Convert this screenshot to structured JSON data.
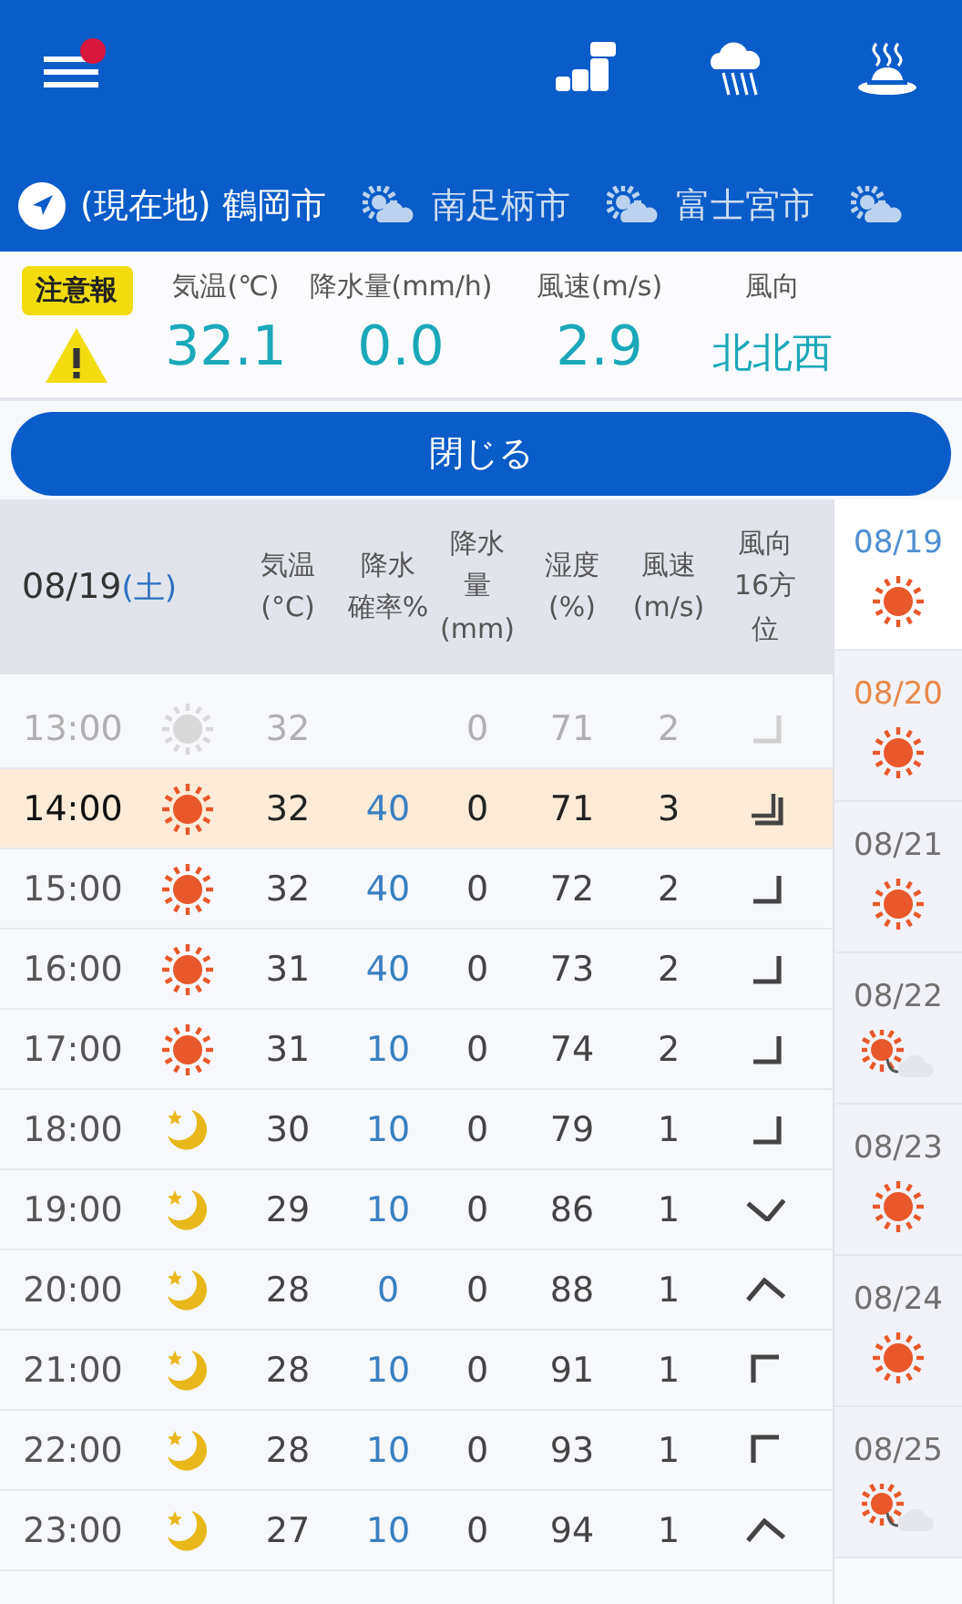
{
  "header": {
    "menu_badge": true,
    "icons": [
      {
        "kind": "blocks"
      },
      {
        "kind": "rain"
      },
      {
        "kind": "onsen"
      }
    ]
  },
  "locations": [
    {
      "kind": "current",
      "label": "(現在地) 鶴岡市",
      "selected": true
    },
    {
      "kind": "partly-cloudy",
      "label": "南足柄市",
      "selected": false
    },
    {
      "kind": "partly-cloudy",
      "label": "富士宮市",
      "selected": false
    },
    {
      "kind": "partly-cloudy",
      "selected": false
    }
  ],
  "now": {
    "alert": "注意報",
    "columns": [
      {
        "label": "気温(℃)",
        "value": "32.1"
      },
      {
        "label": "降水量(mm/h)",
        "value": "0.0"
      },
      {
        "label": "風速(m/s)",
        "value": "2.9"
      },
      {
        "label": "風向",
        "value": "北北西"
      }
    ]
  },
  "close_button": "閉じる",
  "table": {
    "date": "08/19",
    "weekday": "(土)",
    "columns": [
      [
        "気温",
        "(°C)"
      ],
      [
        "降水",
        "確率%"
      ],
      [
        "降水",
        "量",
        "(mm)"
      ],
      [
        "湿度",
        "(%)"
      ],
      [
        "風速",
        "(m/s)"
      ],
      [
        "風向",
        "16方",
        "位"
      ]
    ],
    "rows": [
      {
        "time": "13:00",
        "kind": "sun",
        "temp": "32",
        "pop": "",
        "precip": "0",
        "humidity": "71",
        "wind": "2",
        "arrow": {
          "kind": "se",
          "strong": false
        },
        "past": true,
        "current": false
      },
      {
        "time": "14:00",
        "kind": "sun",
        "temp": "32",
        "pop": "40",
        "precip": "0",
        "humidity": "71",
        "wind": "3",
        "arrow": {
          "kind": "se",
          "strong": true
        },
        "past": false,
        "current": true
      },
      {
        "time": "15:00",
        "kind": "sun",
        "temp": "32",
        "pop": "40",
        "precip": "0",
        "humidity": "72",
        "wind": "2",
        "arrow": {
          "kind": "se",
          "strong": false
        },
        "past": false,
        "current": false
      },
      {
        "time": "16:00",
        "kind": "sun",
        "temp": "31",
        "pop": "40",
        "precip": "0",
        "humidity": "73",
        "wind": "2",
        "arrow": {
          "kind": "se",
          "strong": false
        },
        "past": false,
        "current": false
      },
      {
        "time": "17:00",
        "kind": "sun",
        "temp": "31",
        "pop": "10",
        "precip": "0",
        "humidity": "74",
        "wind": "2",
        "arrow": {
          "kind": "se",
          "strong": false
        },
        "past": false,
        "current": false
      },
      {
        "time": "18:00",
        "kind": "moon",
        "temp": "30",
        "pop": "10",
        "precip": "0",
        "humidity": "79",
        "wind": "1",
        "arrow": {
          "kind": "se",
          "strong": false
        },
        "past": false,
        "current": false
      },
      {
        "time": "19:00",
        "kind": "moon",
        "temp": "29",
        "pop": "10",
        "precip": "0",
        "humidity": "86",
        "wind": "1",
        "arrow": {
          "kind": "s",
          "strong": false
        },
        "past": false,
        "current": false
      },
      {
        "time": "20:00",
        "kind": "moon",
        "temp": "28",
        "pop": "0",
        "precip": "0",
        "humidity": "88",
        "wind": "1",
        "arrow": {
          "kind": "n",
          "strong": false
        },
        "past": false,
        "current": false
      },
      {
        "time": "21:00",
        "kind": "moon",
        "temp": "28",
        "pop": "10",
        "precip": "0",
        "humidity": "91",
        "wind": "1",
        "arrow": {
          "kind": "nw",
          "strong": false
        },
        "past": false,
        "current": false
      },
      {
        "time": "22:00",
        "kind": "moon",
        "temp": "28",
        "pop": "10",
        "precip": "0",
        "humidity": "93",
        "wind": "1",
        "arrow": {
          "kind": "nw",
          "strong": false
        },
        "past": false,
        "current": false
      },
      {
        "time": "23:00",
        "kind": "moon",
        "temp": "27",
        "pop": "10",
        "precip": "0",
        "humidity": "94",
        "wind": "1",
        "arrow": {
          "kind": "n",
          "strong": false
        },
        "past": false,
        "current": false
      }
    ]
  },
  "days": [
    {
      "date": "08/19",
      "color": "#4f8fd0",
      "kind": "sun",
      "selected": true
    },
    {
      "date": "08/20",
      "color": "#e8884a",
      "kind": "sun",
      "selected": false
    },
    {
      "date": "08/21",
      "color": "#707070",
      "kind": "sun",
      "selected": false
    },
    {
      "date": "08/22",
      "color": "#707070",
      "kind": "sun-cloud",
      "selected": false
    },
    {
      "date": "08/23",
      "color": "#707070",
      "kind": "sun",
      "selected": false
    },
    {
      "date": "08/24",
      "color": "#707070",
      "kind": "sun",
      "selected": false
    },
    {
      "date": "08/25",
      "color": "#707070",
      "kind": "sun-cloud",
      "selected": false
    }
  ]
}
